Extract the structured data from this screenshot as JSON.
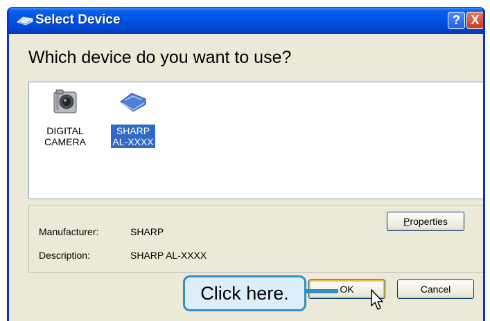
{
  "window": {
    "title": "Select Device",
    "help_label": "?",
    "close_label": "X"
  },
  "heading": "Which device do you want to use?",
  "devices": [
    {
      "label": "DIGITAL\nCAMERA",
      "icon": "camera-icon",
      "selected": false
    },
    {
      "label": "SHARP\nAL-XXXX",
      "icon": "scanner-icon",
      "selected": true
    }
  ],
  "details": {
    "manufacturer_key": "Manufacturer:",
    "manufacturer_value": "SHARP",
    "description_key": "Description:",
    "description_value": "SHARP AL-XXXX"
  },
  "buttons": {
    "properties_prefix": "",
    "properties_mnemonic": "P",
    "properties_rest": "roperties",
    "ok": "OK",
    "cancel": "Cancel"
  },
  "callout": "Click here.",
  "colors": {
    "titlebar": "#0054e3",
    "selection": "#316ac5",
    "callout_border": "#2e8fc6",
    "callout_fill": "#dbeef9"
  }
}
